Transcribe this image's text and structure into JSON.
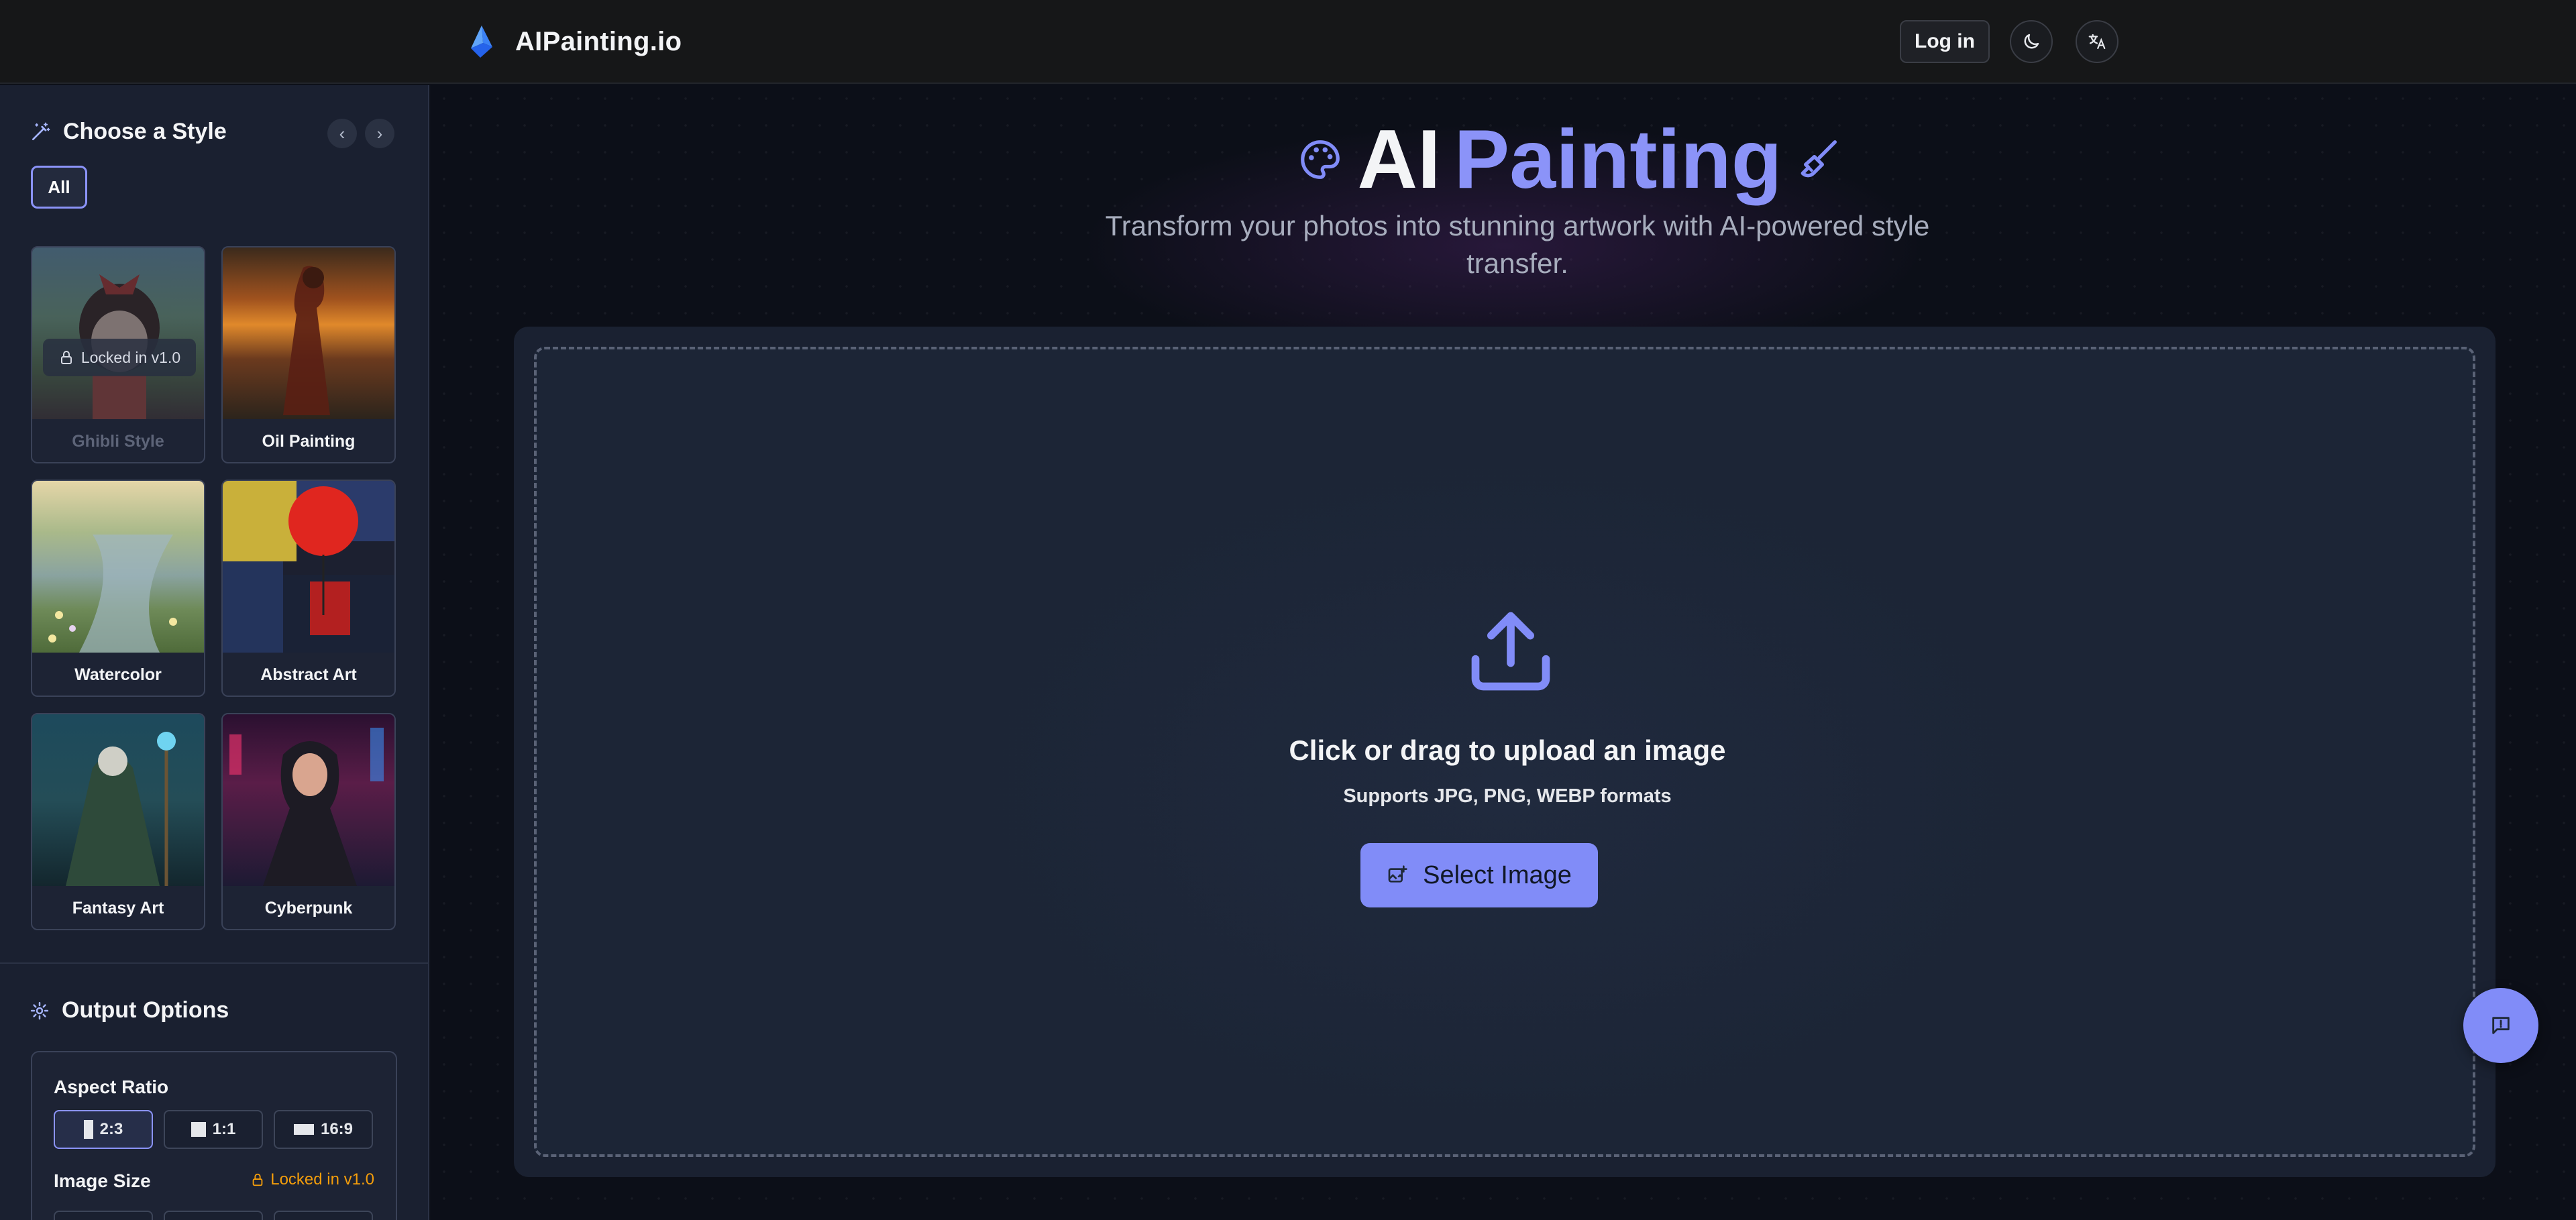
{
  "header": {
    "brand_name": "AIPainting.io",
    "logo_icon": "paint-logo-icon",
    "login_label": "Log in",
    "theme_icon": "moon-icon",
    "language_icon": "translate-icon"
  },
  "sidebar": {
    "style_section_title": "Choose a Style",
    "style_section_icon": "magic-wand-icon",
    "filter_all_label": "All",
    "styles": [
      {
        "label": "Ghibli Style",
        "locked": true,
        "lock_text": "Locked in v1.0"
      },
      {
        "label": "Oil Painting",
        "locked": false
      },
      {
        "label": "Watercolor",
        "locked": false
      },
      {
        "label": "Abstract Art",
        "locked": false
      },
      {
        "label": "Fantasy Art",
        "locked": false
      },
      {
        "label": "Cyberpunk",
        "locked": false
      }
    ],
    "output_section_title": "Output Options",
    "output_section_icon": "gear-icon",
    "aspect_ratio_label": "Aspect Ratio",
    "aspect_ratios": [
      {
        "label": "2:3",
        "selected": true
      },
      {
        "label": "1:1",
        "selected": false
      },
      {
        "label": "16:9",
        "selected": false
      }
    ],
    "image_size_label": "Image Size",
    "image_size_locked_text": "Locked in v1.0"
  },
  "main": {
    "title_word1": "AI",
    "title_word2": "Painting",
    "subtitle": "Transform your photos into stunning artwork with AI-powered style transfer.",
    "upload_title": "Click or drag to upload an image",
    "upload_hint": "Supports JPG, PNG, WEBP formats",
    "select_button_label": "Select Image"
  },
  "colors": {
    "accent": "#818cf8",
    "warning": "#f59e0b",
    "background": "#0c0f18",
    "sidebar": "#1a2030"
  }
}
